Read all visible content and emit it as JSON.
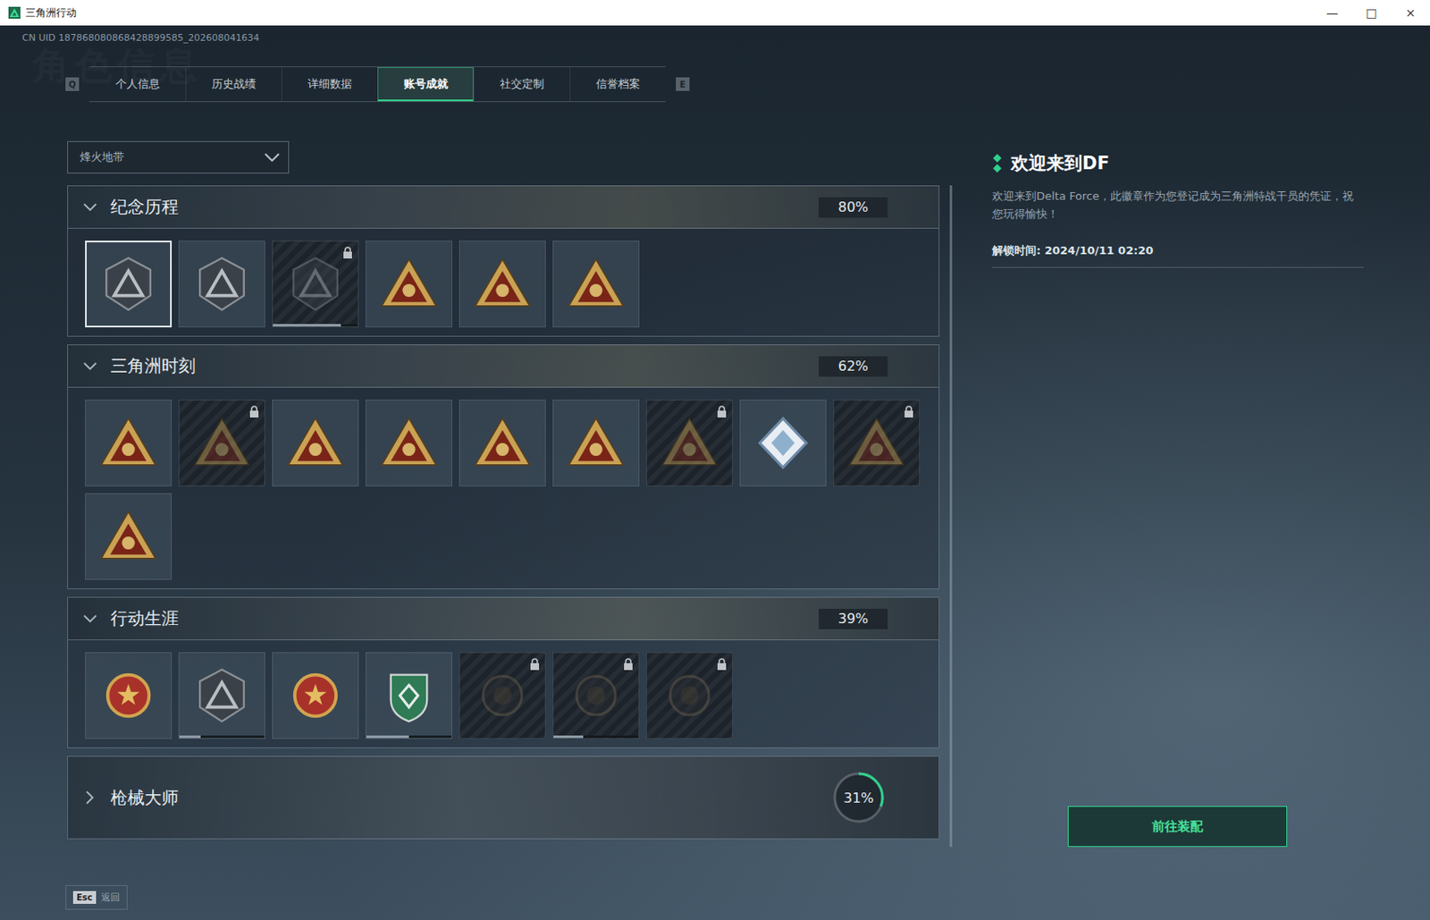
{
  "window": {
    "title": "三角洲行动",
    "controls": [
      "—",
      "□",
      "×"
    ]
  },
  "uid": "CN UID 187868080868428899585_202608041634",
  "watermark": "角色信息",
  "tabs": {
    "prev_key": "Q",
    "next_key": "E",
    "items": [
      {
        "label": "个人信息",
        "selected": false
      },
      {
        "label": "历史战绩",
        "selected": false
      },
      {
        "label": "详细数据",
        "selected": false
      },
      {
        "label": "账号成就",
        "selected": true
      },
      {
        "label": "社交定制",
        "selected": false
      },
      {
        "label": "信誉档案",
        "selected": false
      }
    ]
  },
  "mode_select": {
    "value": "烽火地带"
  },
  "sections": [
    {
      "title": "纪念历程",
      "percent": "80%",
      "kind": "box",
      "expanded": true,
      "badges": [
        {
          "kind": "shield",
          "locked": false,
          "selected": true,
          "level": 0
        },
        {
          "kind": "shield",
          "locked": false,
          "selected": false,
          "level": 0
        },
        {
          "kind": "shield",
          "locked": true,
          "selected": false,
          "level": 0.8
        },
        {
          "kind": "triangle",
          "locked": false,
          "selected": false,
          "level": 0
        },
        {
          "kind": "triangle",
          "locked": false,
          "selected": false,
          "level": 0
        },
        {
          "kind": "triangle",
          "locked": false,
          "selected": false,
          "level": 0
        }
      ]
    },
    {
      "title": "三角洲时刻",
      "percent": "62%",
      "kind": "box",
      "expanded": true,
      "badges": [
        {
          "kind": "triangle",
          "locked": false,
          "selected": false,
          "level": 0
        },
        {
          "kind": "triangle",
          "locked": true,
          "selected": false,
          "level": 0
        },
        {
          "kind": "triangle",
          "locked": false,
          "selected": false,
          "level": 0
        },
        {
          "kind": "triangle",
          "locked": false,
          "selected": false,
          "level": 0
        },
        {
          "kind": "triangle",
          "locked": false,
          "selected": false,
          "level": 0
        },
        {
          "kind": "triangle",
          "locked": false,
          "selected": false,
          "level": 0
        },
        {
          "kind": "triangle",
          "locked": true,
          "selected": false,
          "level": 0
        },
        {
          "kind": "diamond",
          "locked": false,
          "selected": false,
          "level": 0
        },
        {
          "kind": "triangle",
          "locked": true,
          "selected": false,
          "level": 0
        },
        {
          "kind": "triangle",
          "locked": false,
          "selected": false,
          "level": 0
        }
      ]
    },
    {
      "title": "行动生涯",
      "percent": "39%",
      "kind": "box",
      "expanded": true,
      "badges": [
        {
          "kind": "medal",
          "locked": false,
          "selected": false,
          "level": 0
        },
        {
          "kind": "shield",
          "locked": false,
          "selected": false,
          "level": 0.25
        },
        {
          "kind": "medal",
          "locked": false,
          "selected": false,
          "level": 0
        },
        {
          "kind": "crest",
          "locked": false,
          "selected": false,
          "level": 0.5
        },
        {
          "kind": "coin",
          "locked": true,
          "selected": false,
          "level": 0
        },
        {
          "kind": "coin",
          "locked": true,
          "selected": false,
          "level": 0.35
        },
        {
          "kind": "coin",
          "locked": true,
          "selected": false,
          "level": 0
        }
      ]
    },
    {
      "title": "枪械大师",
      "percent": "31%",
      "kind": "ring",
      "level": 0.31,
      "expanded": false,
      "badges": []
    }
  ],
  "detail": {
    "title": "欢迎来到DF",
    "description": "欢迎来到Delta Force，此徽章作为您登记成为三角洲特战干员的凭证，祝您玩得愉快！",
    "unlock_time": "解锁时间: 2024/10/11 02:20",
    "button": "前往装配"
  },
  "footer": {
    "key": "Esc",
    "label": "返回"
  }
}
